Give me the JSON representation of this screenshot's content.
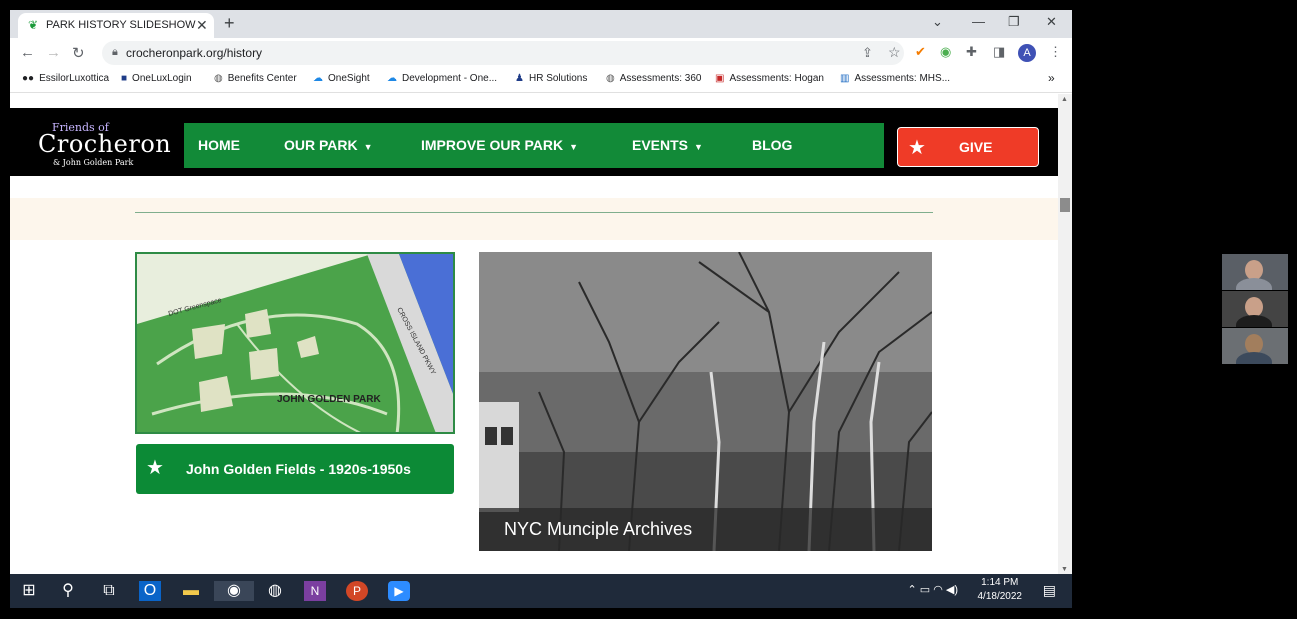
{
  "browser": {
    "tab_title": "PARK HISTORY SLIDESHOW",
    "url": "crocheronpark.org/history",
    "avatar_letter": "A",
    "bookmarks": [
      {
        "label": "EssilorLuxottica",
        "icon": "dots-icon"
      },
      {
        "label": "OneLuxLogin",
        "icon": "square-icon"
      },
      {
        "label": "Benefits Center",
        "icon": "globe-icon"
      },
      {
        "label": "OneSight",
        "icon": "cloud-icon"
      },
      {
        "label": "Development - One...",
        "icon": "cloud-icon"
      },
      {
        "label": "HR Solutions",
        "icon": "people-icon"
      },
      {
        "label": "Assessments: 360",
        "icon": "globe-icon"
      },
      {
        "label": "Assessments: Hogan",
        "icon": "h-icon"
      },
      {
        "label": "Assessments: MHS...",
        "icon": "chart-icon"
      }
    ]
  },
  "site": {
    "logo": {
      "line1": "Friends of",
      "line2": "Crocheron",
      "line3": "& John Golden Park"
    },
    "nav": [
      {
        "label": "HOME",
        "dropdown": false
      },
      {
        "label": "OUR PARK",
        "dropdown": true
      },
      {
        "label": "IMPROVE OUR PARK",
        "dropdown": true
      },
      {
        "label": "EVENTS",
        "dropdown": true
      },
      {
        "label": "BLOG",
        "dropdown": false
      }
    ],
    "give_label": "GIVE",
    "map": {
      "label_top": "DOT Greenspace",
      "label_right": "CROSS ISLAND PKWY",
      "label_park": "JOHN GOLDEN PARK"
    },
    "slide_caption": "John Golden Fields - 1920s-1950s",
    "photo_caption": "NYC Munciple Archives"
  },
  "taskbar": {
    "time": "1:14 PM",
    "date": "4/18/2022"
  },
  "colors": {
    "nav_green": "#128a38",
    "give_red": "#ef3b27",
    "caption_green": "#0c8a36"
  }
}
